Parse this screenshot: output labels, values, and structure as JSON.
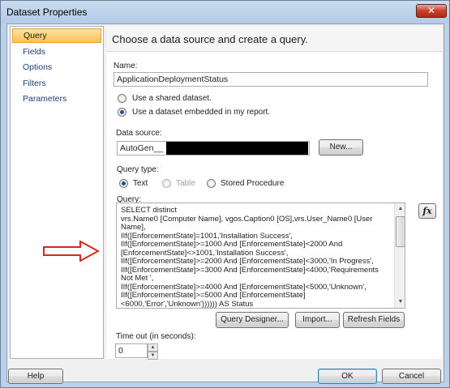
{
  "window": {
    "title": "Dataset Properties",
    "close_glyph": "✕"
  },
  "nav": {
    "items": [
      "Query",
      "Fields",
      "Options",
      "Filters",
      "Parameters"
    ],
    "active": "Query"
  },
  "header": {
    "title": "Choose a data source and create a query."
  },
  "name": {
    "label": "Name:",
    "value": "ApplicationDeploymentStatus"
  },
  "dataset_source": {
    "options": [
      "Use a shared dataset.",
      "Use a dataset embedded in my report."
    ],
    "selected": "Use a dataset embedded in my report."
  },
  "data_source": {
    "label": "Data source:",
    "value": "AutoGen__",
    "new_button": "New..."
  },
  "query_type": {
    "label": "Query type:",
    "options": [
      "Text",
      "Table",
      "Stored Procedure"
    ],
    "selected": "Text",
    "disabled": [
      "Table"
    ]
  },
  "query": {
    "label": "Query:",
    "text": "SELECT distinct\nvrs.Name0 [Computer Name], vgos.Caption0 [OS],vrs.User_Name0 [User Name],\nIIf([EnforcementState]=1001,'Installation Success',\nIIf([EnforcementState]>=1000 And [EnforcementState]<2000 And [EnforcementState]<>1001,'Installation Success',\nIIf([EnforcementState]>=2000 And [EnforcementState]<3000,'In Progress',\nIIf([EnforcementState]>=3000 And [EnforcementState]<4000,'Requirements Not Met ',\nIIf([EnforcementState]>=4000 And [EnforcementState]<5000,'Unknown',\nIIf([EnforcementState]>=5000 And [EnforcementState]<6000,'Error','Unknown')))))) AS Status",
    "fx_label": "fx"
  },
  "query_buttons": {
    "designer": "Query Designer...",
    "import": "Import...",
    "refresh": "Refresh Fields"
  },
  "timeout": {
    "label": "Time out (in seconds):",
    "value": "0"
  },
  "footer": {
    "help": "Help",
    "ok": "OK",
    "cancel": "Cancel"
  },
  "colors": {
    "accent_arrow": "#d42a1f",
    "nav_active": "#f8c257"
  }
}
